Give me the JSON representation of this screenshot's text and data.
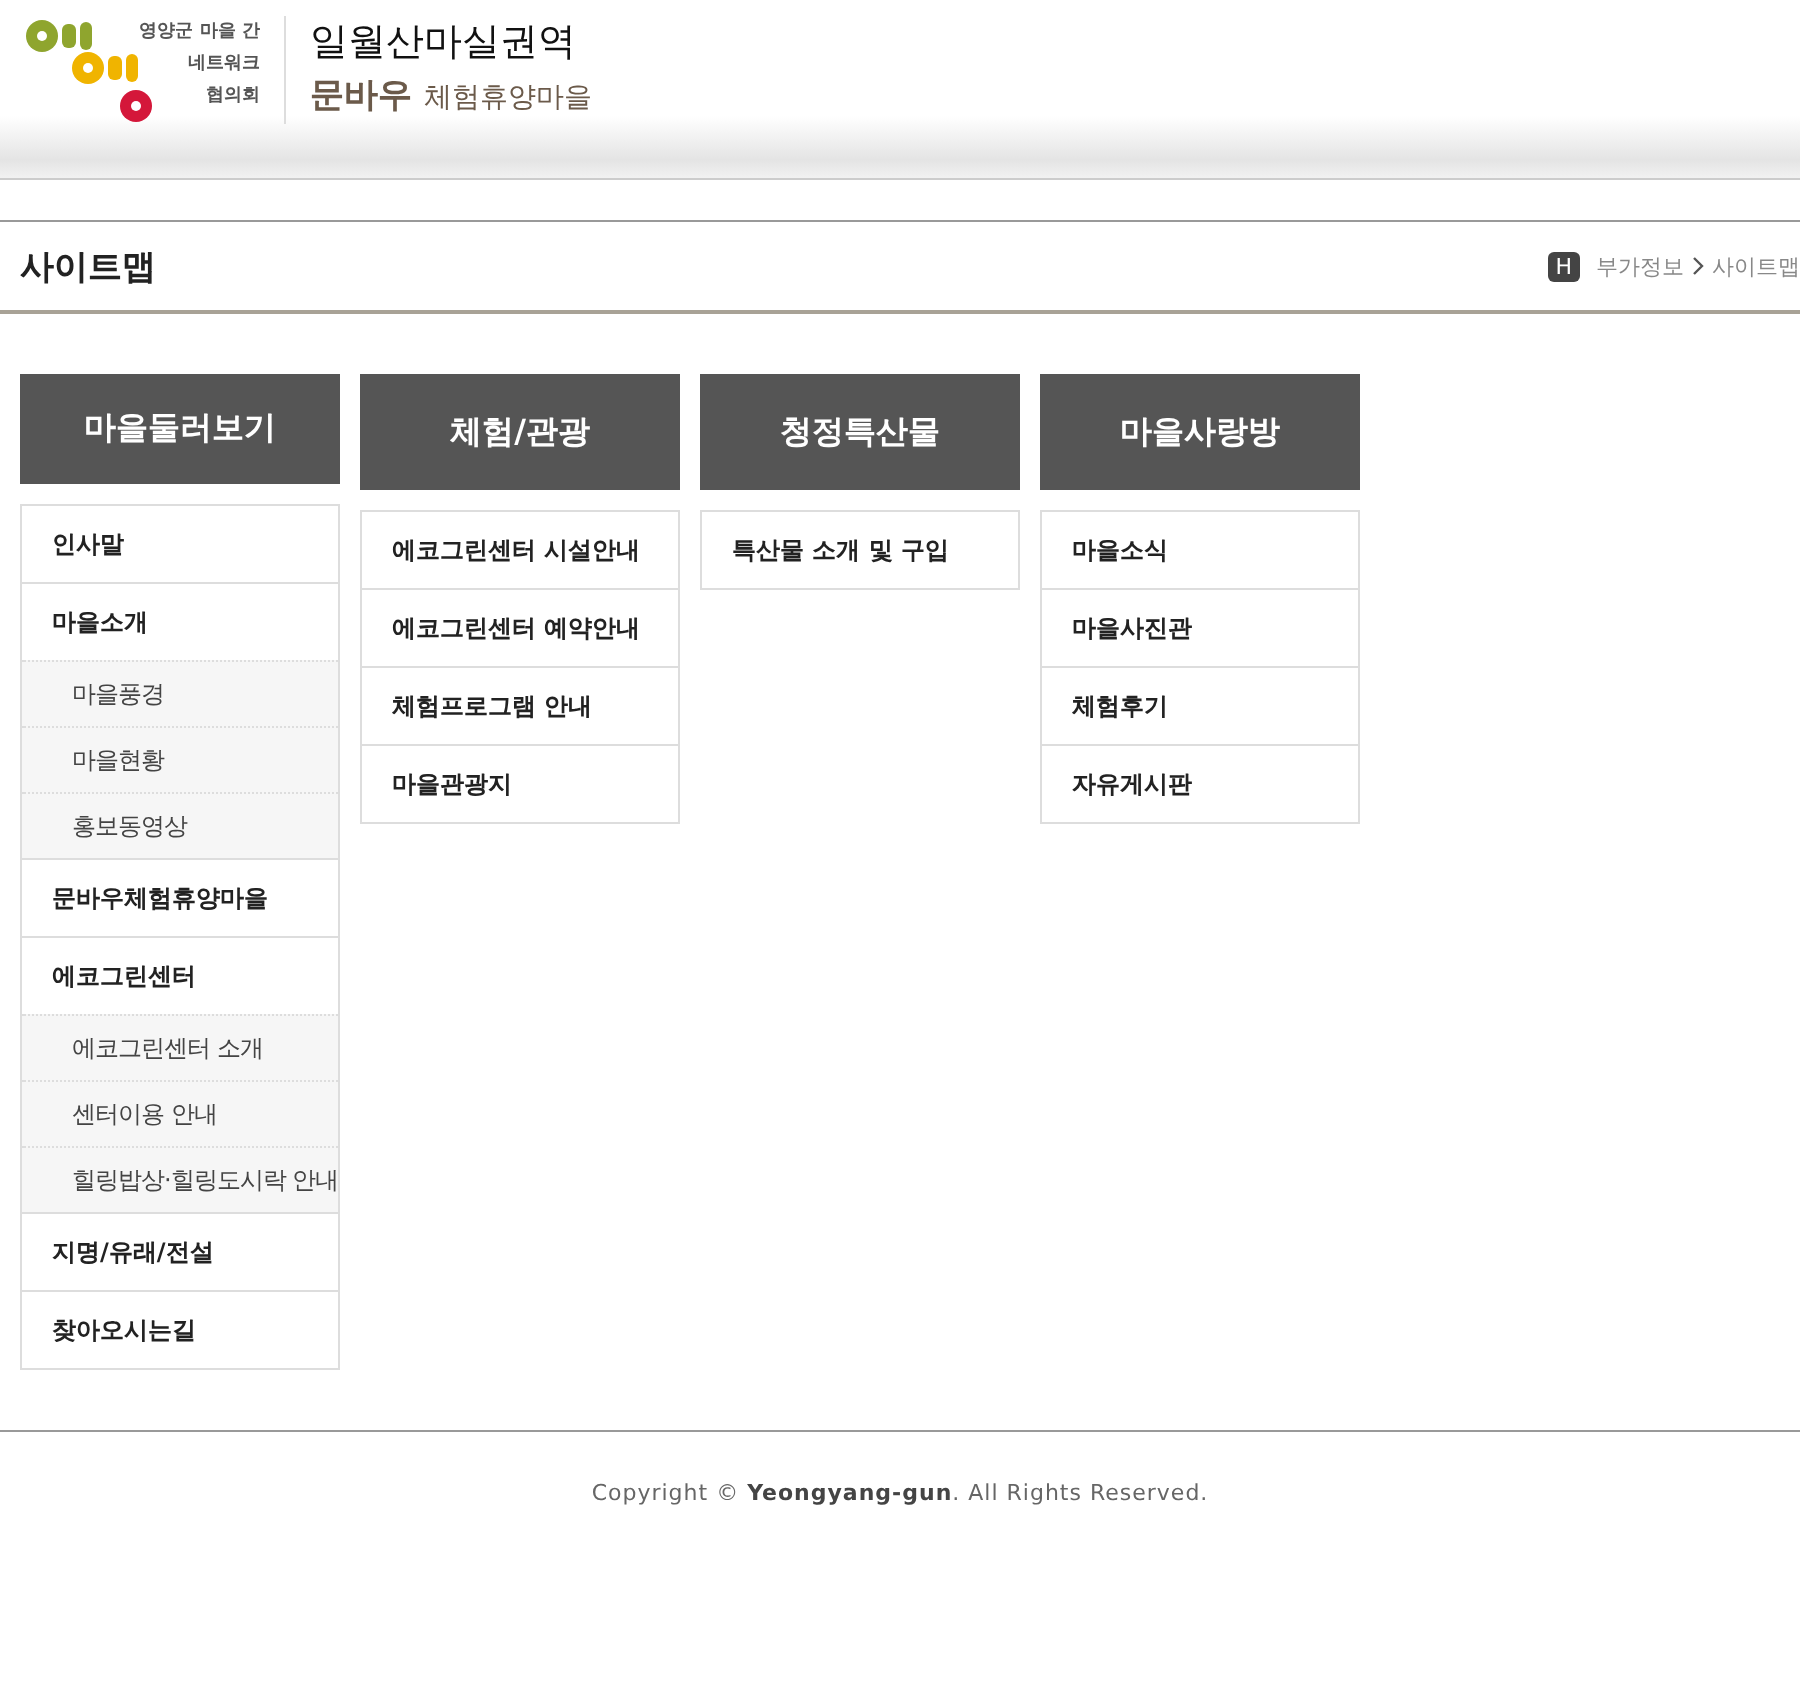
{
  "header": {
    "logo_text": [
      "영양군 마을 간",
      "네트워크",
      "협의회"
    ],
    "title": "일월산마실권역",
    "brand": "문바우",
    "subtitle": "체험휴양마을"
  },
  "page": {
    "title": "사이트맵",
    "breadcrumb_icon": "H",
    "breadcrumb": [
      "부가정보",
      "사이트맵"
    ]
  },
  "columns": [
    {
      "title": "마을둘러보기",
      "items": [
        {
          "label": "인사말"
        },
        {
          "label": "마을소개",
          "children": [
            {
              "label": "마을풍경"
            },
            {
              "label": "마을현황"
            },
            {
              "label": "홍보동영상"
            }
          ]
        },
        {
          "label": "문바우체험휴양마을"
        },
        {
          "label": "에코그린센터",
          "children": [
            {
              "label": "에코그린센터 소개"
            },
            {
              "label": "센터이용 안내"
            },
            {
              "label": "힐링밥상·힐링도시락 안내"
            }
          ]
        },
        {
          "label": "지명/유래/전설"
        },
        {
          "label": "찾아오시는길"
        }
      ]
    },
    {
      "title": "체험/관광",
      "items": [
        {
          "label": "에코그린센터 시설안내"
        },
        {
          "label": "에코그린센터 예약안내"
        },
        {
          "label": "체험프로그램 안내"
        },
        {
          "label": "마을관광지"
        }
      ]
    },
    {
      "title": "청정특산물",
      "items": [
        {
          "label": "특산물 소개 및 구입"
        }
      ]
    },
    {
      "title": "마을사랑방",
      "items": [
        {
          "label": "마을소식"
        },
        {
          "label": "마을사진관"
        },
        {
          "label": "체험후기"
        },
        {
          "label": "자유게시판"
        }
      ]
    }
  ],
  "footer": {
    "copyright": "Copyright © **Yeongyang-gun**. All Rights Reserved."
  }
}
